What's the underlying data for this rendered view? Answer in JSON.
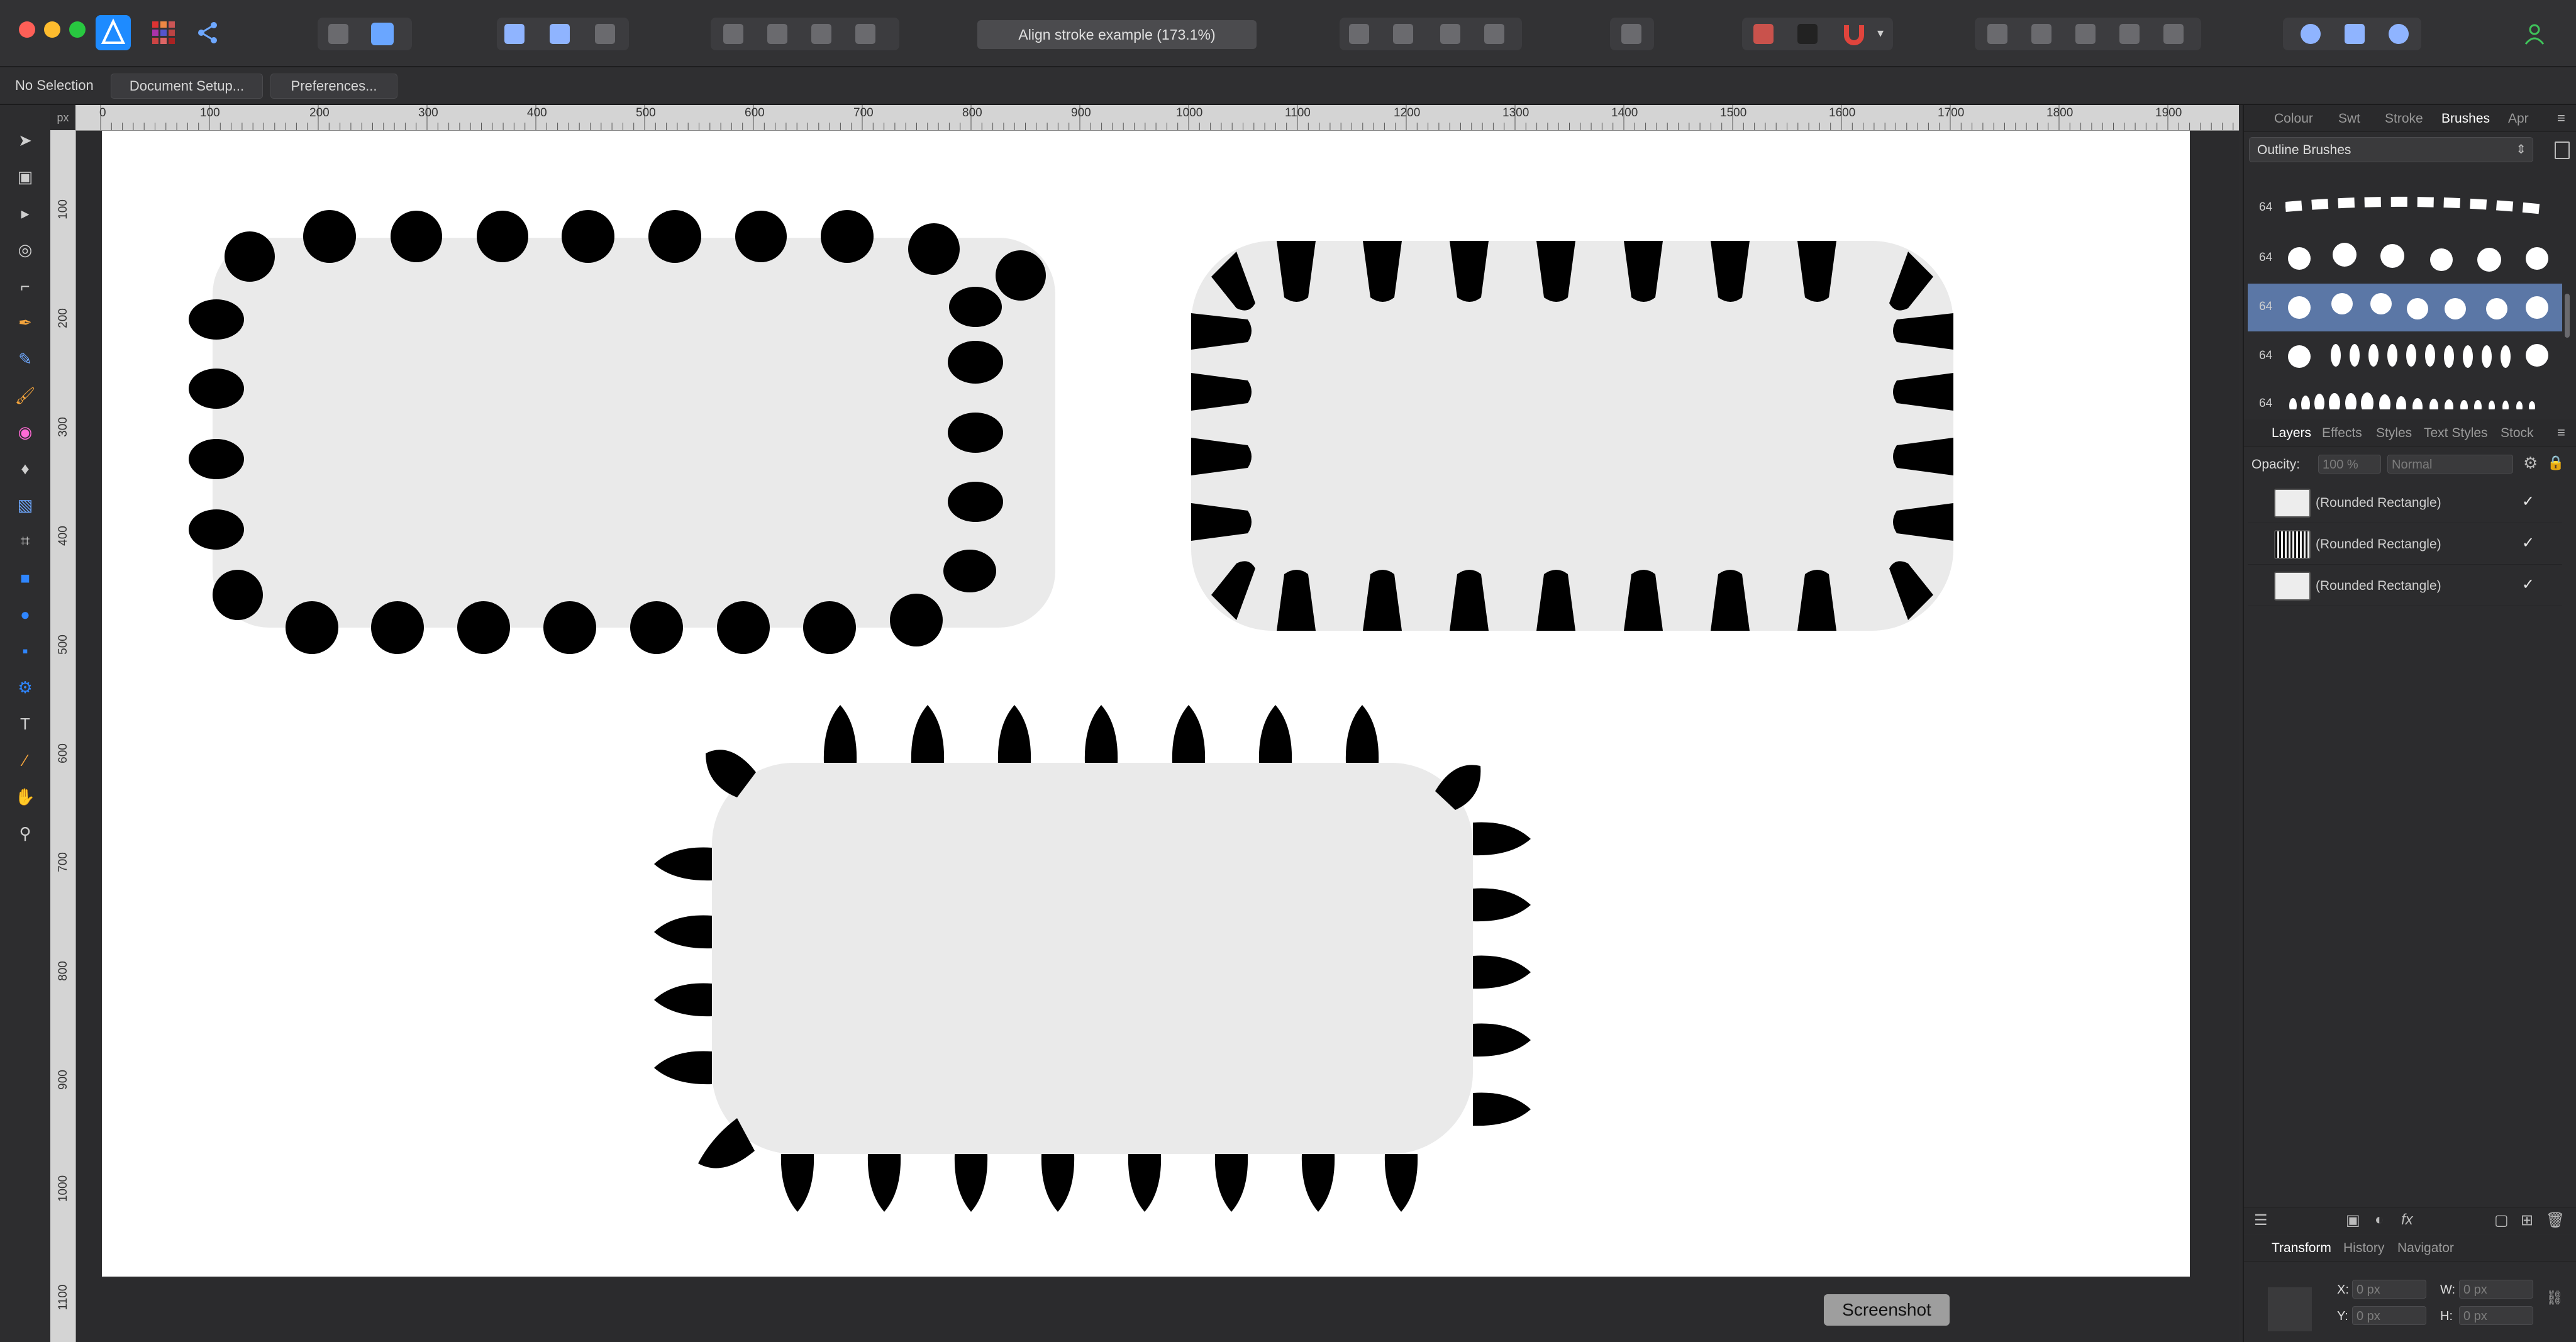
{
  "window": {
    "title": "Align stroke example (173.1%)",
    "traffic_colors": [
      "#ff5f57",
      "#febc2e",
      "#28c840"
    ]
  },
  "context_toolbar": {
    "selection_status": "No Selection",
    "document_setup_label": "Document Setup...",
    "preferences_label": "Preferences..."
  },
  "rulers": {
    "unit": "px",
    "top_ticks": [
      "0",
      "100",
      "200",
      "300",
      "400",
      "500",
      "600",
      "700",
      "800",
      "900",
      "1000",
      "1100",
      "1200",
      "1300",
      "1400",
      "1500",
      "1600",
      "1700",
      "1800",
      "1900"
    ],
    "left_ticks": [
      "100",
      "200",
      "300",
      "400",
      "500",
      "600",
      "700",
      "800",
      "900",
      "1000",
      "1100"
    ]
  },
  "tools": [
    "move-tool-icon",
    "artboard-tool-icon",
    "node-tool-icon",
    "corner-tool-icon",
    "point-transform-icon",
    "pen-tool-icon",
    "pencil-tool-icon",
    "paint-brush-icon",
    "fill-tool-icon",
    "transparency-tool-icon",
    "place-image-icon",
    "crop-tool-icon",
    "rectangle-tool-icon",
    "ellipse-tool-icon",
    "rounded-rectangle-icon",
    "shape-gear-icon",
    "text-tool-icon",
    "color-picker-icon",
    "hand-tool-icon",
    "zoom-tool-icon"
  ],
  "studio_top": {
    "tabs": [
      "Colour",
      "Swt",
      "Stroke",
      "Brushes",
      "Apr"
    ],
    "active_tab": "Brushes",
    "category": "Outline Brushes",
    "brushes": [
      {
        "size": "64",
        "selected": false
      },
      {
        "size": "64",
        "selected": false
      },
      {
        "size": "64",
        "selected": true
      },
      {
        "size": "64",
        "selected": false
      },
      {
        "size": "64",
        "selected": false
      }
    ]
  },
  "layers_panel": {
    "tabs": [
      "Layers",
      "Effects",
      "Styles",
      "Text Styles",
      "Stock"
    ],
    "active_tab": "Layers",
    "opacity_label": "Opacity:",
    "opacity_value": "100 %",
    "blend_mode": "Normal",
    "layers": [
      {
        "name": "(Rounded Rectangle)",
        "visible": "✓"
      },
      {
        "name": "(Rounded Rectangle)",
        "visible": "✓"
      },
      {
        "name": "(Rounded Rectangle)",
        "visible": "✓"
      }
    ]
  },
  "transform_panel": {
    "tabs": [
      "Transform",
      "History",
      "Navigator"
    ],
    "active_tab": "Transform",
    "x_label": "X:",
    "x_value": "0 px",
    "y_label": "Y:",
    "y_value": "0 px",
    "w_label": "W:",
    "w_value": "0 px",
    "h_label": "H:",
    "h_value": "0 px"
  },
  "tooltip": "Screenshot",
  "colors": {
    "shape_fill": "#eaeaea",
    "stroke": "#000000",
    "selected_brush_row": "#5b77a6",
    "accent_blue": "#1e8bff"
  }
}
